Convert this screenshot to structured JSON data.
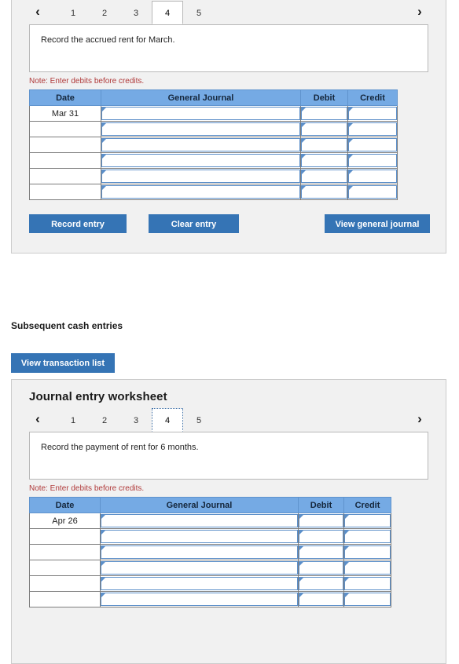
{
  "page": {
    "section_heading": "Subsequent cash entries",
    "transaction_list_button": "View transaction list"
  },
  "colors": {
    "accent_button": "#3574b5",
    "table_header": "#75aae4",
    "note_text": "#b03a3a",
    "panel_background": "#f1f1f1"
  },
  "panel_top": {
    "nav": {
      "prev_icon": "chevron-left-icon",
      "next_icon": "chevron-right-icon",
      "prev_label": "‹",
      "next_label": "›"
    },
    "tabs": [
      {
        "label": "1",
        "active": false
      },
      {
        "label": "2",
        "active": false
      },
      {
        "label": "3",
        "active": false
      },
      {
        "label": "4",
        "active": true
      },
      {
        "label": "5",
        "active": false
      }
    ],
    "description": "Record the accrued rent for March.",
    "note": "Note: Enter debits before credits.",
    "table": {
      "headers": [
        "Date",
        "General Journal",
        "Debit",
        "Credit"
      ],
      "rows": [
        {
          "date": "Mar 31",
          "journal": "",
          "debit": "",
          "credit": ""
        },
        {
          "date": "",
          "journal": "",
          "debit": "",
          "credit": ""
        },
        {
          "date": "",
          "journal": "",
          "debit": "",
          "credit": ""
        },
        {
          "date": "",
          "journal": "",
          "debit": "",
          "credit": ""
        },
        {
          "date": "",
          "journal": "",
          "debit": "",
          "credit": ""
        },
        {
          "date": "",
          "journal": "",
          "debit": "",
          "credit": ""
        }
      ]
    },
    "buttons": {
      "record": "Record entry",
      "clear": "Clear entry",
      "view_journal": "View general journal"
    }
  },
  "panel_bottom": {
    "title": "Journal entry worksheet",
    "nav": {
      "prev_icon": "chevron-left-icon",
      "next_icon": "chevron-right-icon",
      "prev_label": "‹",
      "next_label": "›"
    },
    "tabs": [
      {
        "label": "1",
        "active": false
      },
      {
        "label": "2",
        "active": false
      },
      {
        "label": "3",
        "active": false
      },
      {
        "label": "4",
        "active": true
      },
      {
        "label": "5",
        "active": false
      }
    ],
    "description": "Record the payment of rent for 6 months.",
    "note": "Note: Enter debits before credits.",
    "table": {
      "headers": [
        "Date",
        "General Journal",
        "Debit",
        "Credit"
      ],
      "rows": [
        {
          "date": "Apr 26",
          "journal": "",
          "debit": "",
          "credit": ""
        },
        {
          "date": "",
          "journal": "",
          "debit": "",
          "credit": ""
        },
        {
          "date": "",
          "journal": "",
          "debit": "",
          "credit": ""
        },
        {
          "date": "",
          "journal": "",
          "debit": "",
          "credit": ""
        },
        {
          "date": "",
          "journal": "",
          "debit": "",
          "credit": ""
        },
        {
          "date": "",
          "journal": "",
          "debit": "",
          "credit": ""
        }
      ]
    }
  }
}
